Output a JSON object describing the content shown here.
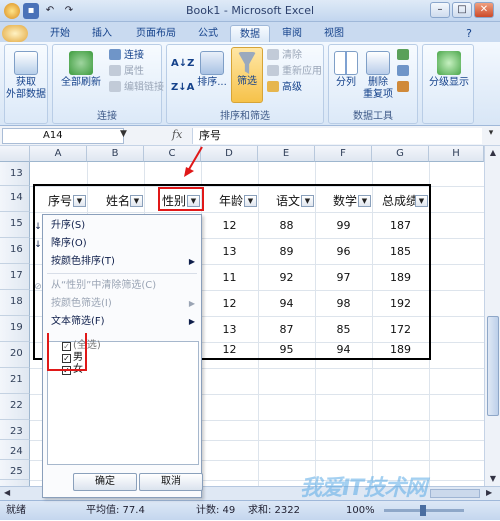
{
  "window": {
    "title": "Book1 - Microsoft Excel"
  },
  "tabs": [
    "开始",
    "插入",
    "页面布局",
    "公式",
    "数据",
    "审阅",
    "视图"
  ],
  "active_tab": "数据",
  "ribbon": {
    "get_external_data": "获取\n外部数据",
    "refresh_all": "全部刷新",
    "connections": "连接",
    "properties": "属性",
    "edit_links": "编辑链接",
    "connections_group": "连接",
    "sort_az": "A↓Z",
    "sort_za": "Z↓A",
    "sort": "排序...",
    "filter": "筛选",
    "clear": "清除",
    "reapply": "重新应用",
    "advanced": "高级",
    "sort_filter_group": "排序和筛选",
    "text_to_columns": "分列",
    "remove_duplicates": "删除\n重复项",
    "data_tools_group": "数据工具",
    "outline": "分级显示"
  },
  "formula_bar": {
    "name_box": "A14",
    "fx": "fx",
    "value": "序号"
  },
  "columns": [
    "A",
    "B",
    "C",
    "D",
    "E",
    "F",
    "G",
    "H"
  ],
  "rows": [
    "13",
    "14",
    "15",
    "16",
    "17",
    "18",
    "19",
    "20",
    "21",
    "22",
    "23",
    "24",
    "25",
    "26"
  ],
  "table": {
    "headers": [
      "序号",
      "姓名",
      "性别",
      "年龄",
      "语文",
      "数学",
      "总成绩"
    ],
    "rows": [
      {
        "age": "12",
        "chinese": "88",
        "math": "99",
        "total": "187"
      },
      {
        "age": "13",
        "chinese": "89",
        "math": "96",
        "total": "185"
      },
      {
        "age": "11",
        "chinese": "92",
        "math": "97",
        "total": "189"
      },
      {
        "age": "12",
        "chinese": "94",
        "math": "98",
        "total": "192"
      },
      {
        "age": "13",
        "chinese": "87",
        "math": "85",
        "total": "172"
      },
      {
        "age": "12",
        "chinese": "95",
        "math": "94",
        "total": "189"
      }
    ]
  },
  "filter_menu": {
    "sort_asc": "升序(S)",
    "sort_desc": "降序(O)",
    "sort_by_color": "按颜色排序(T)",
    "clear_filter": "从“性别”中清除筛选(C)",
    "filter_by_color": "按颜色筛选(I)",
    "text_filter": "文本筛选(F)",
    "select_all": "(全选)",
    "options": [
      "男",
      "女"
    ],
    "ok": "确定",
    "cancel": "取消"
  },
  "status": {
    "ready": "就绪",
    "average": "平均值: 77.4",
    "count": "计数: 49",
    "sum": "求和: 2322",
    "zoom": "100%"
  },
  "watermark": "我爱IT技术网"
}
